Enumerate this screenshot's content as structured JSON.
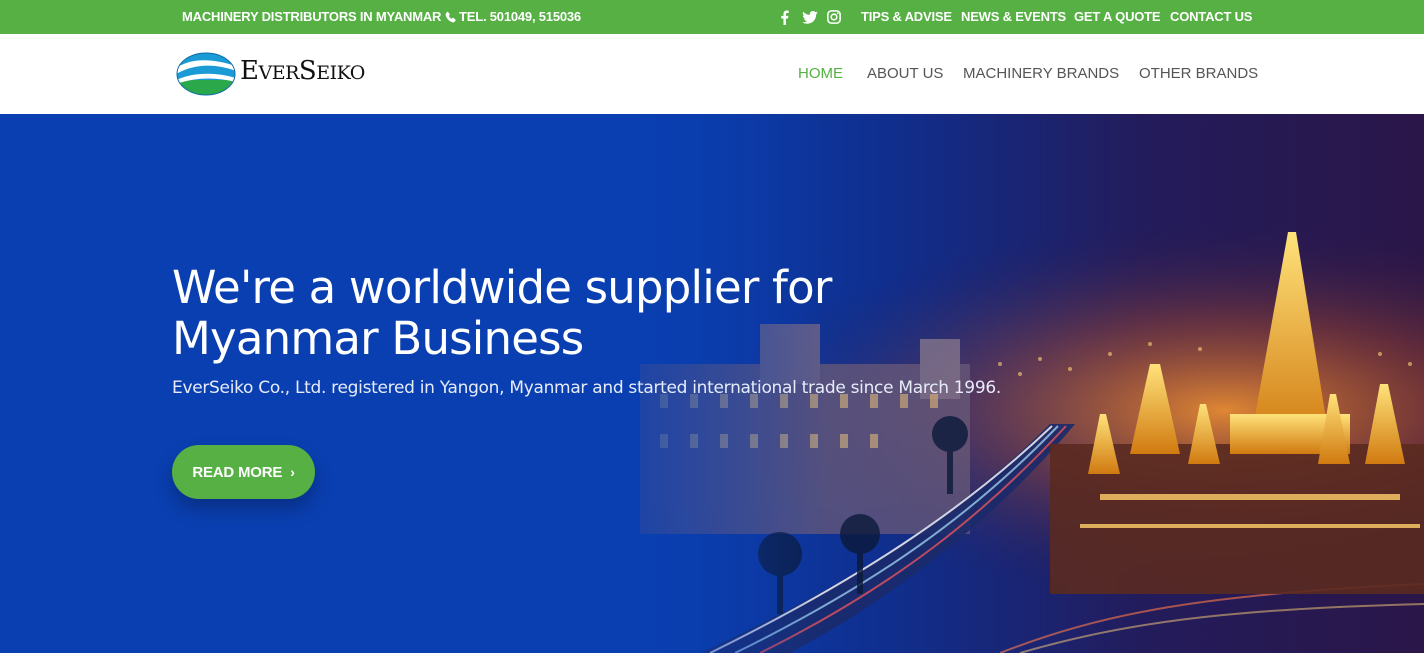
{
  "topbar": {
    "tagline": "MACHINERY DISTRIBUTORS IN MYANMAR",
    "phone": "TEL. 501049, 515036",
    "social": [
      {
        "icon": "facebook-icon"
      },
      {
        "icon": "twitter-icon"
      },
      {
        "icon": "instagram-icon"
      }
    ],
    "links": [
      "TIPS & ADVISE",
      "NEWS & EVENTS",
      "GET A QUOTE",
      "CONTACT US"
    ],
    "bg_color": "#56b044"
  },
  "header": {
    "logo_text_first": "E",
    "logo_text_second": "VER",
    "logo_text_third": "S",
    "logo_text_fourth": "EIKO",
    "nav": [
      {
        "label": "HOME",
        "active": true
      },
      {
        "label": "ABOUT US",
        "active": false
      },
      {
        "label": "MACHINERY BRANDS",
        "active": false
      },
      {
        "label": "OTHER BRANDS",
        "active": false
      }
    ],
    "accent_color": "#56b044"
  },
  "hero": {
    "title": "We're a worldwide supplier for Myanmar Business",
    "subtitle": "EverSeiko Co., Ltd. registered in Yangon, Myanmar and started international trade since March 1996.",
    "button_label": "READ MORE",
    "bg_color": "#0a3fb1"
  }
}
